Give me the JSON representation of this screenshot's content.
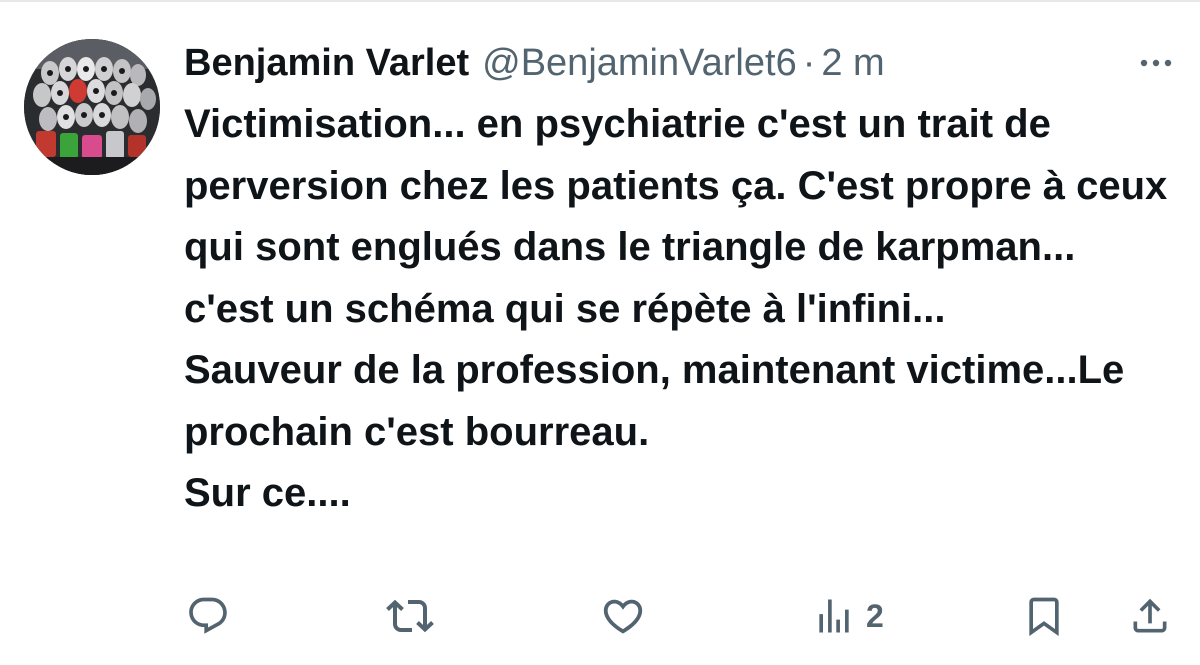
{
  "tweet": {
    "author_name": "Benjamin Varlet",
    "handle": "@BenjaminVarlet6",
    "separator": "·",
    "time": "2 m",
    "text": "Victimisation... en psychiatrie c'est un trait de perversion chez les patients ça. C'est propre à ceux qui sont englués dans le triangle de karpman... c'est un schéma qui se répète à l'infini...\nSauveur de la profession, maintenant victime...Le prochain c'est bourreau.\nSur ce....",
    "avatar_icon": "profile-photo"
  },
  "actions": {
    "reply_icon": "reply-icon",
    "retweet_icon": "retweet-icon",
    "like_icon": "like-icon",
    "views_icon": "views-icon",
    "views_count": "2",
    "bookmark_icon": "bookmark-icon",
    "share_icon": "share-icon",
    "more_icon": "more-icon"
  },
  "colors": {
    "text": "#0f1419",
    "secondary": "#536471",
    "icon": "#536471",
    "divider": "#e6e9ec"
  }
}
